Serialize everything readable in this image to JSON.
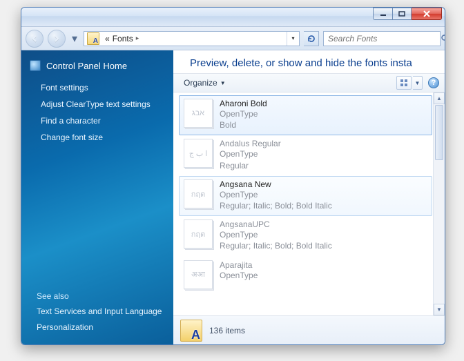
{
  "titlebar": {},
  "nav": {
    "breadcrumb_prefix": "«",
    "breadcrumb_label": "Fonts",
    "search_placeholder": "Search Fonts"
  },
  "sidebar": {
    "home_label": "Control Panel Home",
    "links": [
      "Font settings",
      "Adjust ClearType text settings",
      "Find a character",
      "Change font size"
    ],
    "see_also_label": "See also",
    "see_also_links": [
      "Text Services and Input Language",
      "Personalization"
    ]
  },
  "main": {
    "heading": "Preview, delete, or show and hide the fonts insta",
    "organize_label": "Organize",
    "help_glyph": "?"
  },
  "fonts": [
    {
      "name": "Aharoni Bold",
      "tech": "OpenType",
      "styles": "Bold",
      "sample": "אבג",
      "state": "selected"
    },
    {
      "name": "Andalus Regular",
      "tech": "OpenType",
      "styles": "Regular",
      "sample": "ا ب ج",
      "state": "dimmed"
    },
    {
      "name": "Angsana New",
      "tech": "OpenType",
      "styles": "Regular; Italic; Bold; Bold Italic",
      "sample": "กฤต",
      "state": "hovered"
    },
    {
      "name": "AngsanaUPC",
      "tech": "OpenType",
      "styles": "Regular; Italic; Bold; Bold Italic",
      "sample": "กฤต",
      "state": "dimmed"
    },
    {
      "name": "Aparajita",
      "tech": "OpenType",
      "styles": "",
      "sample": "अआ",
      "state": "dimmed"
    }
  ],
  "status": {
    "count_text": "136 items"
  }
}
